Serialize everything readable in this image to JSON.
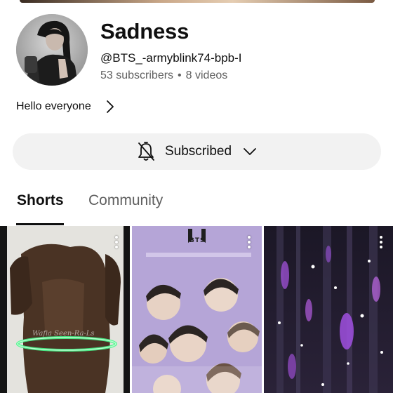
{
  "channel": {
    "name": "Sadness",
    "handle": "@BTS_-armyblink74-bpb-I",
    "subscribers": "53 subscribers",
    "videos": "8 videos",
    "separator": "•",
    "description": "Hello everyone"
  },
  "subscribe": {
    "label": "Subscribed",
    "bell_icon": "bell-off-icon",
    "dropdown_icon": "chevron-down-icon"
  },
  "tabs": [
    {
      "label": "Shorts",
      "active": true
    },
    {
      "label": "Community",
      "active": false
    }
  ],
  "shorts": [
    {
      "overlay_text": "Wafia Seen-Ra-Ls",
      "thumbnail": "brown-dress-figure"
    },
    {
      "logo_text": "BTS",
      "thumbnail": "bts-group-photo"
    },
    {
      "thumbnail": "purple-sparkle-lights"
    }
  ],
  "colors": {
    "text_primary": "#0f0f0f",
    "text_secondary": "#606060",
    "button_bg": "#f2f2f2",
    "active_underline": "#0f0f0f"
  }
}
